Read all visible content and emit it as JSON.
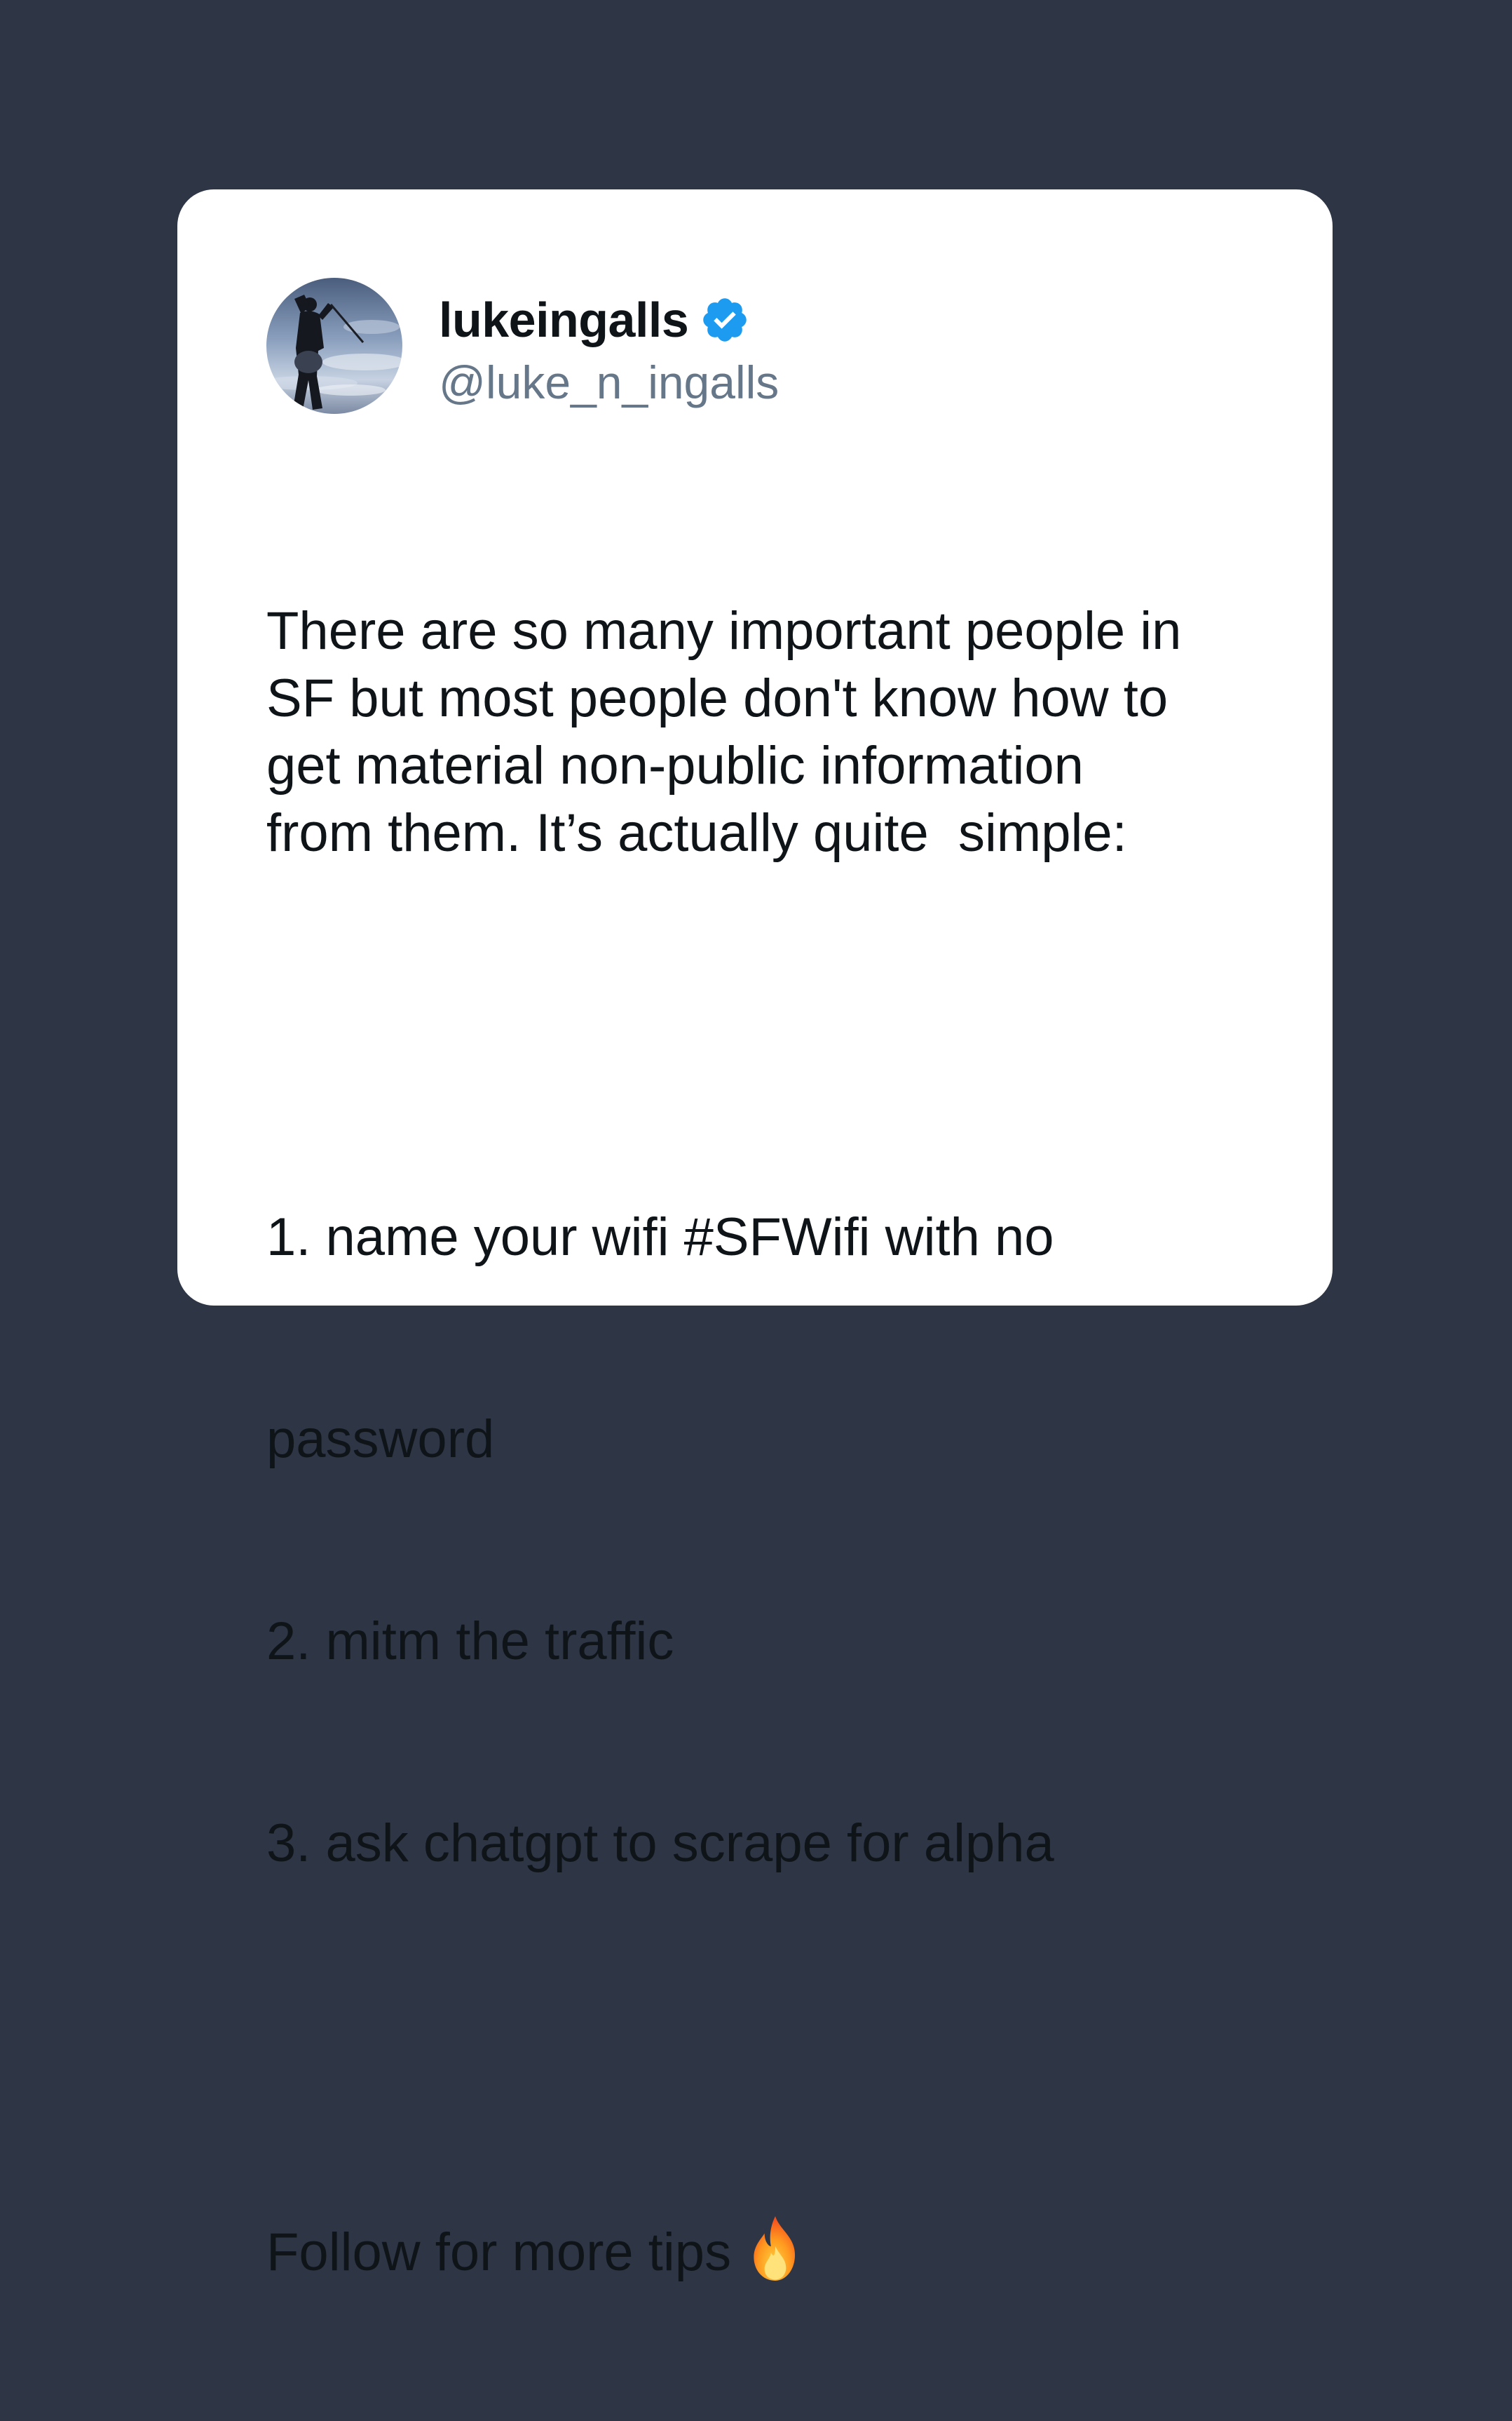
{
  "tweet": {
    "display_name": "lukeingalls",
    "handle": "@luke_n_ingalls",
    "verified_icon": "verified-badge-icon",
    "avatar_icon": "golfer-silhouette-avatar",
    "intro": "There are so many important people in\nSF but most people don't know how to\nget material non-public information\nfrom them. It’s actually quite  simple:",
    "list_lines": [
      "1. name your wifi #SFWifi with no",
      "password",
      "2. mitm the traffic",
      "3. ask chatgpt to scrape for alpha"
    ],
    "closing": "Follow for more tips",
    "closing_emoji": "fire-icon"
  },
  "colors": {
    "background": "#2e3646",
    "card": "#ffffff",
    "text": "#0f1419",
    "handle": "#66778a",
    "verified": "#1d9bf0"
  }
}
